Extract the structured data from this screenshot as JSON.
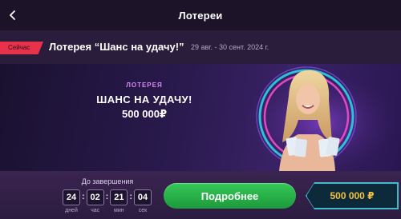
{
  "header": {
    "title": "Лотереи",
    "back_icon": "chevron-left-icon"
  },
  "lottery": {
    "badge": "Сейчас",
    "name": "Лотерея “Шанс на удачу!”",
    "dates": "29 авг. - 30 сент. 2024 г."
  },
  "banner": {
    "kicker": "ЛОТЕРЕЯ",
    "headline": "ШАНС НА УДАЧУ!",
    "amount": "500 000₽"
  },
  "countdown": {
    "label": "До завершения",
    "units": [
      {
        "value": "24",
        "caption": "дней"
      },
      {
        "value": "02",
        "caption": "час"
      },
      {
        "value": "21",
        "caption": "мин"
      },
      {
        "value": "04",
        "caption": "сек"
      }
    ]
  },
  "actions": {
    "details_label": "Подробнее"
  },
  "prize": {
    "amount": "500 000 ₽"
  },
  "colors": {
    "accent_green": "#2bb44a",
    "badge_red": "#e8324c",
    "prize_gold": "#f2c23b",
    "prize_border": "#43c2d6"
  }
}
